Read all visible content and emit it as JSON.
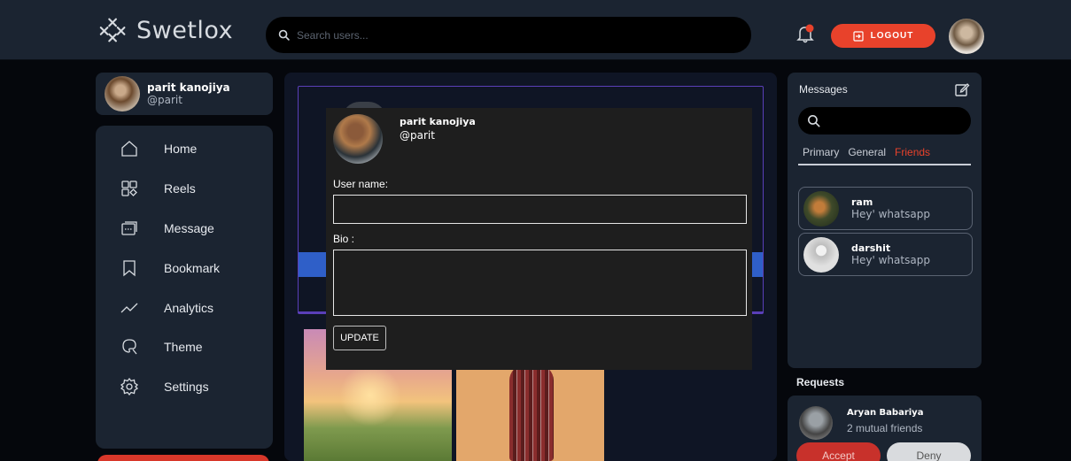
{
  "header": {
    "logo_text": "Swetlox",
    "search_placeholder": "Search users...",
    "logout_label": "LOGOUT"
  },
  "profile": {
    "name": "parit kanojiya",
    "handle": "@parit"
  },
  "sidebar": {
    "items": [
      {
        "label": "Home",
        "icon": "home-icon"
      },
      {
        "label": "Reels",
        "icon": "reels-icon"
      },
      {
        "label": "Message",
        "icon": "message-icon"
      },
      {
        "label": "Bookmark",
        "icon": "bookmark-icon"
      },
      {
        "label": "Analytics",
        "icon": "analytics-icon"
      },
      {
        "label": "Theme",
        "icon": "theme-icon"
      },
      {
        "label": "Settings",
        "icon": "settings-icon"
      }
    ]
  },
  "modal": {
    "name": "parit kanojiya",
    "handle": "@parit",
    "username_label": "User name:",
    "username_value": "",
    "bio_label": "Bio :",
    "bio_value": "",
    "update_label": "UPDATE"
  },
  "messages": {
    "title": "Messages",
    "tabs": [
      "Primary",
      "General",
      "Friends"
    ],
    "active_tab": "Friends",
    "chats": [
      {
        "name": "ram",
        "text": "Hey' whatsapp"
      },
      {
        "name": "darshit",
        "text": "Hey' whatsapp"
      }
    ]
  },
  "requests": {
    "title": "Requests",
    "items": [
      {
        "name": "Aryan Babariya",
        "sub": "2 mutual friends",
        "accept": "Accept",
        "deny": "Deny"
      }
    ]
  },
  "colors": {
    "accent": "#e8422b",
    "panel": "#1b2431",
    "modal": "#1e1e1e"
  }
}
